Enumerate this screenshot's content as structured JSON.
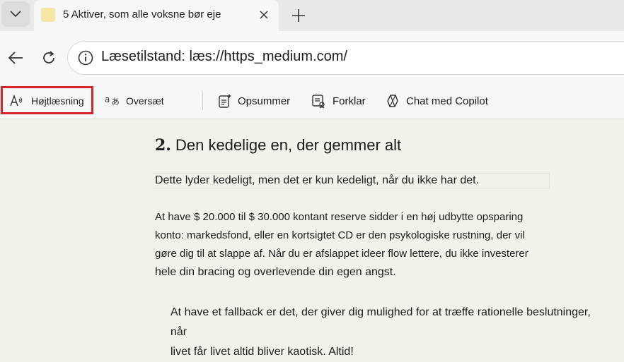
{
  "tab": {
    "title": "5 Aktiver, som alle voksne bør eje"
  },
  "address": {
    "text": "Læsetilstand: læs://https_medium.com/"
  },
  "reader_toolbar": {
    "read_aloud": "Højtlæsning",
    "translate": "Oversæt",
    "summarize": "Opsummer",
    "explain": "Forklar",
    "chat": "Chat med Copilot"
  },
  "article": {
    "heading_number": "2.",
    "heading_text": "Den kedelige en, der gemmer alt",
    "p1": "Dette lyder kedeligt, men det er kun kedeligt, når du ikke har det.",
    "p2_lines": [
      "At have $ 20.000 til $ 30.000 kontant reserve sidder i en høj udbytte opsparing",
      "konto: markedsfond, eller en kortsigtet CD er den psykologiske rustning, der vil",
      "gøre dig til at slappe af. Når du er afslappet ideer flow lettere, du ikke investerer",
      "hele din bracing og overlevende din egen angst."
    ],
    "p3_lines": [
      "At have et fallback er det, der giver dig mulighed for at træffe rationelle beslutninger, når",
      "livet får livet altid bliver kaotisk. Altid!"
    ]
  },
  "colors": {
    "highlight": "#d8232a",
    "page_bg": "#f3f2ea"
  }
}
